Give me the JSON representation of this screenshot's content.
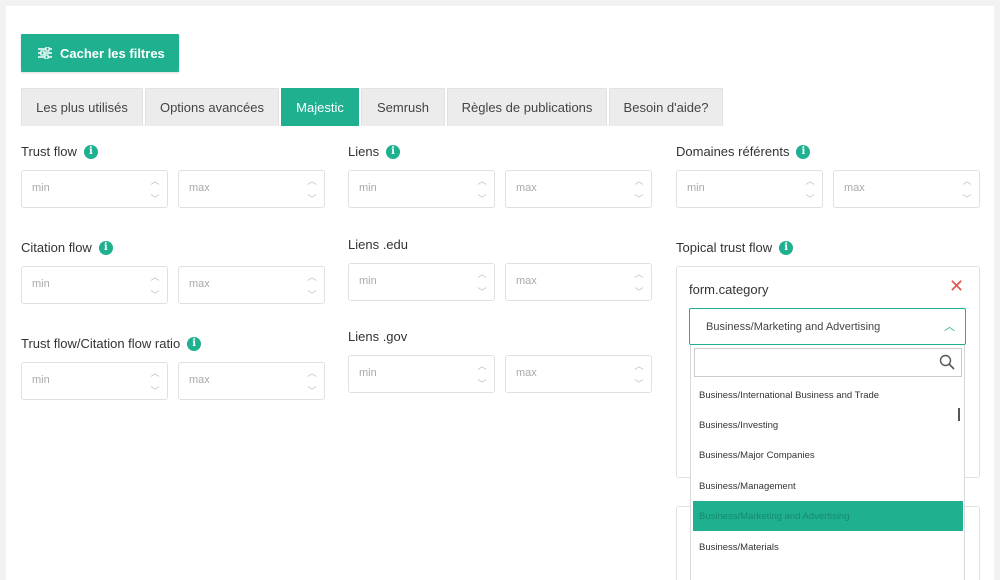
{
  "buttons": {
    "filters_label": "Cacher les filtres"
  },
  "tabs": [
    {
      "label": "Les plus utilisés",
      "active": false
    },
    {
      "label": "Options avancées",
      "active": false
    },
    {
      "label": "Majestic",
      "active": true
    },
    {
      "label": "Semrush",
      "active": false
    },
    {
      "label": "Règles de publications",
      "active": false
    },
    {
      "label": "Besoin d'aide?",
      "active": false
    }
  ],
  "filters": {
    "trust_flow": "Trust flow",
    "citation_flow": "Citation flow",
    "tf_cf_ratio": "Trust flow/Citation flow ratio",
    "liens": "Liens",
    "liens_edu": "Liens .edu",
    "liens_gov": "Liens .gov",
    "domaines_referents": "Domaines référents",
    "topical_trust_flow": "Topical trust flow",
    "placeholder_min": "min",
    "placeholder_max": "max"
  },
  "topical": {
    "form_label": "form.category",
    "selected_value": "Business/Marketing and Advertising",
    "search_value": "",
    "options": [
      "Business/International Business and Trade",
      "Business/Investing",
      "Business/Major Companies",
      "Business/Management",
      "Business/Marketing and Advertising",
      "Business/Materials"
    ],
    "selected_option": "Business/Marketing and Advertising"
  },
  "colors": {
    "accent": "#1fb08f",
    "danger": "#e05555"
  },
  "icons": {
    "filters": "sliders-icon",
    "info": "info-icon",
    "close": "close-icon",
    "chevron": "chevron-up-icon",
    "search": "search-icon"
  }
}
